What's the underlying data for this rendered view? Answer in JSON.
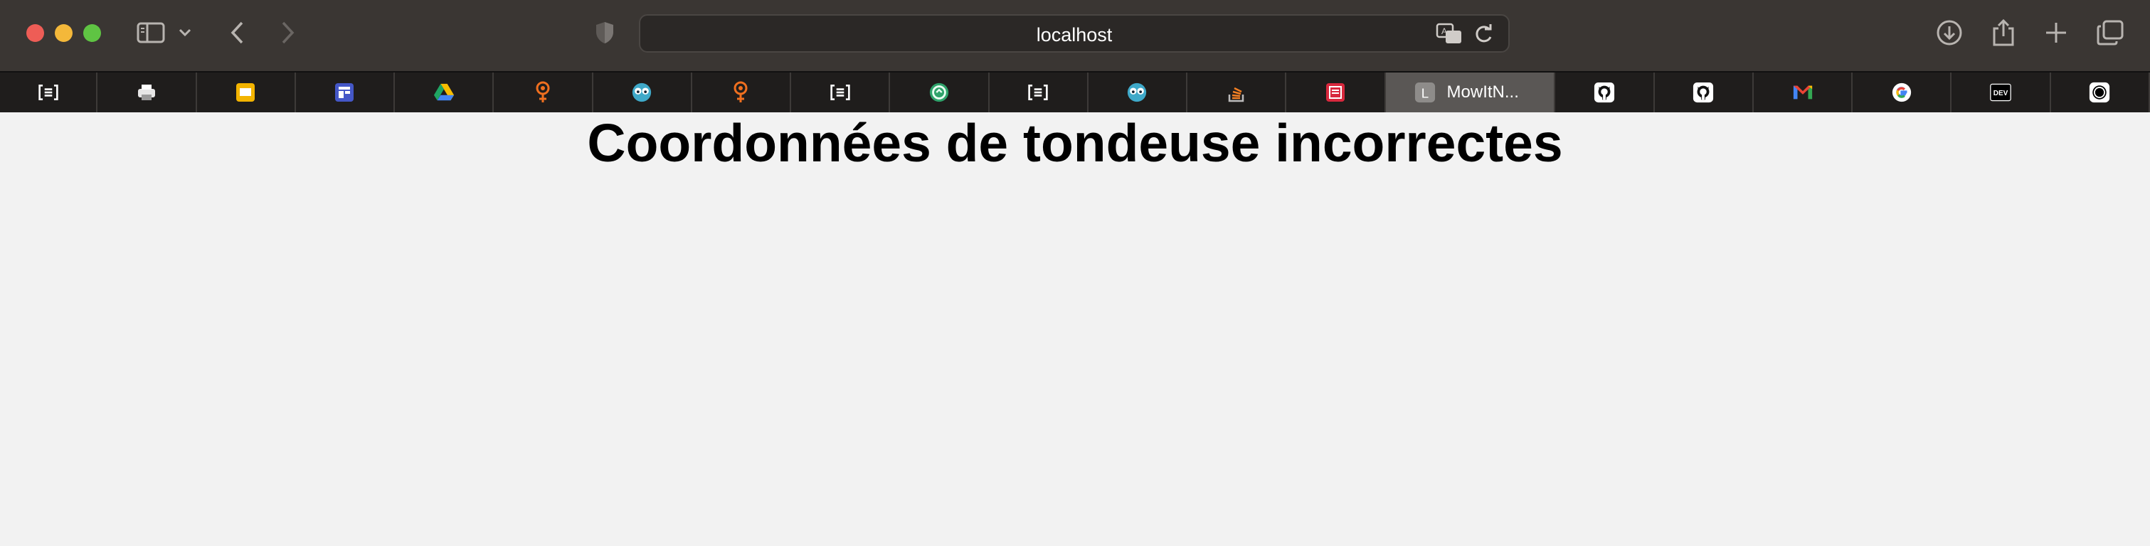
{
  "browser": {
    "url": "localhost",
    "tabs": [
      {
        "name": "tab-reader",
        "icon": "bracket-list-icon",
        "label": ""
      },
      {
        "name": "tab-printer",
        "icon": "printer-icon",
        "label": ""
      },
      {
        "name": "tab-slides",
        "icon": "slides-icon",
        "label": ""
      },
      {
        "name": "tab-board",
        "icon": "board-icon",
        "label": ""
      },
      {
        "name": "tab-drive",
        "icon": "google-drive-icon",
        "label": ""
      },
      {
        "name": "tab-pin-1",
        "icon": "location-pin-icon",
        "label": ""
      },
      {
        "name": "tab-face-1",
        "icon": "face-icon",
        "label": ""
      },
      {
        "name": "tab-pin-2",
        "icon": "location-pin-icon",
        "label": ""
      },
      {
        "name": "tab-reader-2",
        "icon": "bracket-list-icon",
        "label": ""
      },
      {
        "name": "tab-circle-green",
        "icon": "green-circle-icon",
        "label": ""
      },
      {
        "name": "tab-reader-3",
        "icon": "bracket-list-icon",
        "label": ""
      },
      {
        "name": "tab-face-2",
        "icon": "face-icon",
        "label": ""
      },
      {
        "name": "tab-stackoverflow",
        "icon": "stackoverflow-icon",
        "label": ""
      },
      {
        "name": "tab-red-doc",
        "icon": "red-document-icon",
        "label": ""
      },
      {
        "name": "tab-active",
        "icon": "letter-l-icon",
        "label": "MowItN..."
      },
      {
        "name": "tab-github-1",
        "icon": "github-icon",
        "label": ""
      },
      {
        "name": "tab-github-2",
        "icon": "github-icon",
        "label": ""
      },
      {
        "name": "tab-gmail",
        "icon": "gmail-icon",
        "label": ""
      },
      {
        "name": "tab-google",
        "icon": "google-icon",
        "label": ""
      },
      {
        "name": "tab-dev",
        "icon": "dev-icon",
        "label": ""
      },
      {
        "name": "tab-ring",
        "icon": "ring-icon",
        "label": ""
      }
    ]
  },
  "page": {
    "heading": "Coordonnées de tondeuse incorrectes"
  },
  "colors": {
    "toolbar": "#3a3633",
    "tabbar": "#1f1d1c",
    "page_background": "#f2f2f2"
  }
}
